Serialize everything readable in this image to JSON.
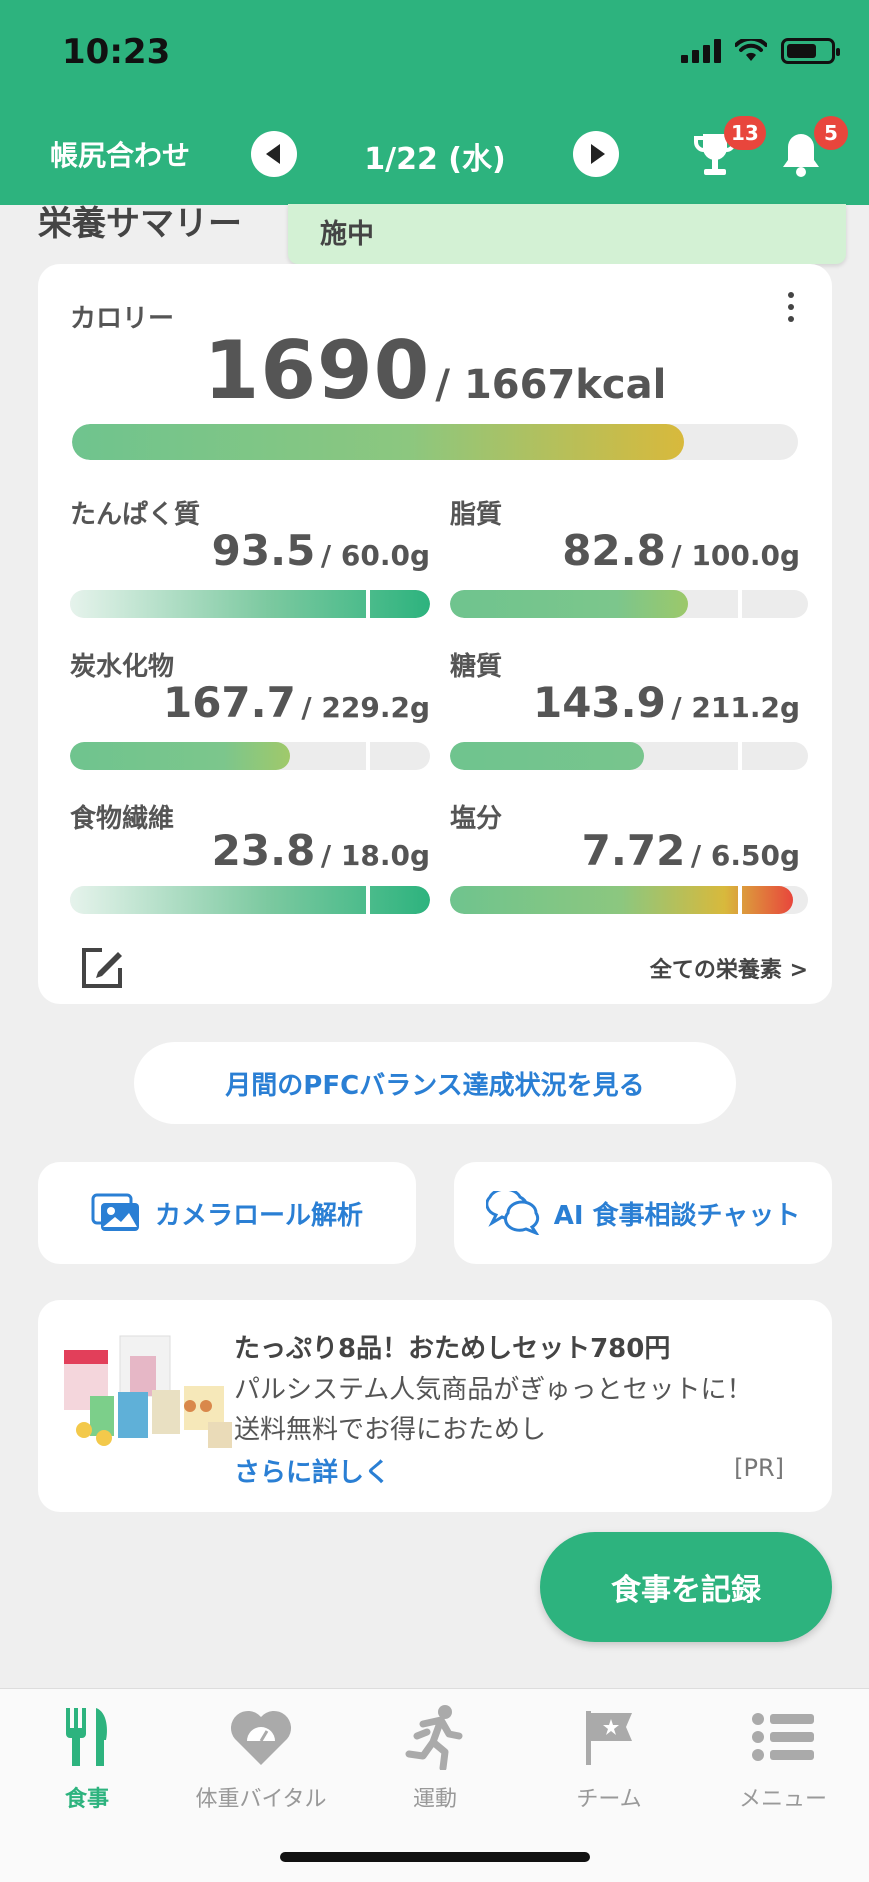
{
  "status_bar": {
    "time": "10:23"
  },
  "header": {
    "title": "帳尻合わせ",
    "date": "1/22 (水)",
    "trophy_badge": "13",
    "bell_badge": "5",
    "icons": [
      "chevron-left-icon",
      "chevron-right-icon",
      "trophy-icon",
      "bell-icon"
    ]
  },
  "section_title": "栄養サマリー",
  "tooltip_text": "施中",
  "calorie": {
    "label": "カロリー",
    "value": "1690",
    "target": "/ 1667kcal",
    "progress": 1.014
  },
  "nutrients": [
    {
      "label": "たんぱく質",
      "value": "93.5",
      "target": "/ 60.0g",
      "progress": 1.56
    },
    {
      "label": "脂質",
      "value": "82.8",
      "target": "/ 100.0g",
      "progress": 0.83
    },
    {
      "label": "炭水化物",
      "value": "167.7",
      "target": "/ 229.2g",
      "progress": 0.73
    },
    {
      "label": "糖質",
      "value": "143.9",
      "target": "/ 211.2g",
      "progress": 0.68
    },
    {
      "label": "食物繊維",
      "value": "23.8",
      "target": "/ 18.0g",
      "progress": 1.32
    },
    {
      "label": "塩分",
      "value": "7.72",
      "target": "/ 6.50g",
      "progress": 1.19
    }
  ],
  "all_nutrients_link": "全ての栄養素 >",
  "pfc_button": "月間のPFCバランス達成状況を見る",
  "camera_roll_button": "カメラロール解析",
  "ai_chat_button": "AI 食事相談チャット",
  "ad": {
    "title": "たっぷり8品！おためしセット780円",
    "line1": "パルシステム人気商品がぎゅっとセットに！",
    "line2": "送料無料でお得におためし",
    "more": "さらに詳しく",
    "pr": "[PR]"
  },
  "record_button": "食事を記録",
  "tabs": [
    {
      "label": "食事",
      "icon": "fork-knife-icon",
      "active": true
    },
    {
      "label": "体重バイタル",
      "icon": "heart-scale-icon",
      "active": false
    },
    {
      "label": "運動",
      "icon": "running-icon",
      "active": false
    },
    {
      "label": "チーム",
      "icon": "flag-icon",
      "active": false
    },
    {
      "label": "メニュー",
      "icon": "menu-list-icon",
      "active": false
    }
  ],
  "colors": {
    "brand_green": "#2db37e",
    "link_blue": "#2a7fd4",
    "badge_red": "#e8463c",
    "tooltip_green": "#d3f1d4"
  }
}
